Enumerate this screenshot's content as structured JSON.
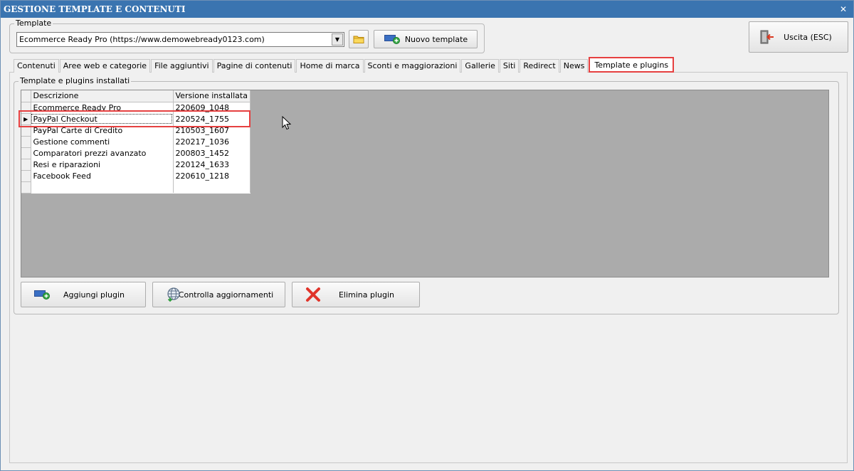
{
  "window": {
    "title": "GESTIONE TEMPLATE E CONTENUTI",
    "close_glyph": "✕"
  },
  "template_group": {
    "legend": "Template",
    "combo_value": "Ecommerce Ready Pro (https://www.demowebready0123.com)",
    "new_template_label": "Nuovo template"
  },
  "exit_button": {
    "label": "Uscita (ESC)"
  },
  "tabs": [
    {
      "label": "Contenuti"
    },
    {
      "label": "Aree web e categorie"
    },
    {
      "label": "File aggiuntivi"
    },
    {
      "label": "Pagine di contenuti"
    },
    {
      "label": "Home di marca"
    },
    {
      "label": "Sconti e maggiorazioni"
    },
    {
      "label": "Gallerie"
    },
    {
      "label": "Siti"
    },
    {
      "label": "Redirect"
    },
    {
      "label": "News"
    },
    {
      "label": "Template e plugins"
    }
  ],
  "active_tab": "Template e plugins",
  "plugins_group": {
    "legend": "Template e plugins installati",
    "columns": [
      "Descrizione",
      "Versione installata"
    ],
    "rows": [
      {
        "descrizione": "Ecommerce Ready Pro",
        "versione": "220609_1048"
      },
      {
        "descrizione": "PayPal Checkout",
        "versione": "220524_1755"
      },
      {
        "descrizione": "PayPal Carte di Credito",
        "versione": "210503_1607"
      },
      {
        "descrizione": "Gestione commenti",
        "versione": "220217_1036"
      },
      {
        "descrizione": "Comparatori prezzi avanzato",
        "versione": "200803_1452"
      },
      {
        "descrizione": "Resi e riparazioni",
        "versione": "220124_1633"
      },
      {
        "descrizione": "Facebook Feed",
        "versione": "220610_1218"
      }
    ],
    "current_row_indicator": "▶"
  },
  "buttons": {
    "add_plugin": "Aggiungi plugin",
    "check_updates": "Controlla aggiornamenti",
    "delete_plugin": "Elimina plugin"
  },
  "colors": {
    "highlight": "#e64040",
    "titlebar": "#3a74b0",
    "grid_background": "#ababab"
  }
}
